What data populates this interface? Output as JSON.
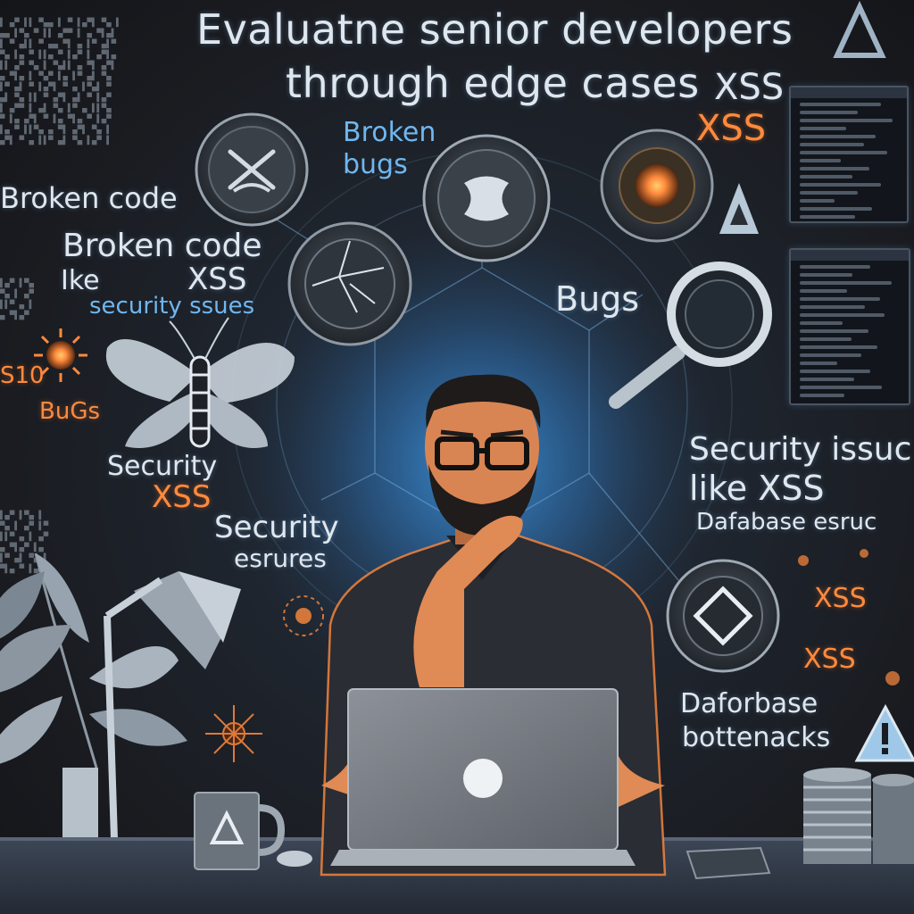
{
  "scene": {
    "title_line1": "Evaluatne senior developers",
    "title_line2": "through edge cases",
    "labels": {
      "title_xss": "XSS",
      "broken_code_small": "Broken code",
      "broken_code_large": "Broken code",
      "like_xss": "like XSS",
      "like_prefix": "Ike",
      "security_issues_left": "security ssues",
      "broken_bugs_1": "Broken",
      "broken_bugs_2": "bugs",
      "xss_top_right": "XSS",
      "bugs_center": "Bugs",
      "bugs_left": "BuGs",
      "security_left": "Security",
      "xss_left": "XSS",
      "security_center": "Security",
      "esrures": "esrures",
      "security_issue_right": "Security issuc",
      "like_xss_right": "like XSS",
      "database_right": "Dafabase esruc",
      "xss_right_1": "XSS",
      "xss_right_2": "XSS",
      "daforbase": "Daforbase",
      "bottenacks": "bottenacks",
      "stray_digits": "S10"
    },
    "colors": {
      "background": "#1b1d22",
      "glow": "#3fa9ff",
      "accent": "#ff8a3d",
      "shirt": "#2a2d33",
      "skin": "#e08a55"
    }
  }
}
